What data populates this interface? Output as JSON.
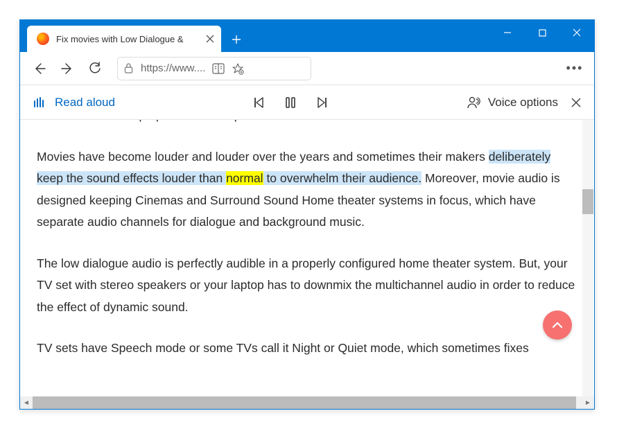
{
  "tab": {
    "title": "Fix movies with Low Dialogue &"
  },
  "addressbar": {
    "url": "https://www...."
  },
  "readbar": {
    "read_aloud_label": "Read aloud",
    "voice_options_label": "Voice options"
  },
  "article": {
    "partial_top": "audio on a TV or laptop with stereo speakers.",
    "p2": {
      "pre": "Movies have become louder and louder over the years and sometimes their makers ",
      "hl_before": "deliberately keep the sound effects louder than ",
      "hl_word": "normal",
      "hl_after": " to overwhelm their audience.",
      "post": " Moreover, movie audio is designed keeping Cinemas and Surround Sound Home theater systems in focus, which have separate audio channels for dialogue and background music."
    },
    "p3": "The low dialogue audio is perfectly audible in a properly configured home theater system. But, your TV set with stereo speakers or your laptop has to downmix the multichannel audio in order to reduce the effect of dynamic sound.",
    "partial_bottom": "TV sets have Speech mode or some TVs call it Night or Quiet mode, which sometimes fixes"
  }
}
